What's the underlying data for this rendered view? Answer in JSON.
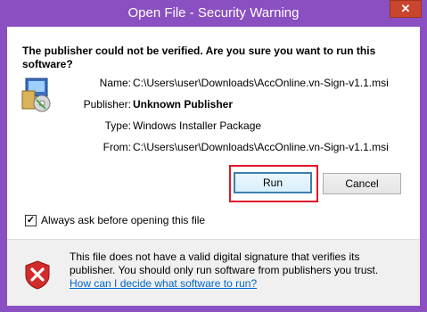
{
  "window": {
    "title": "Open File - Security Warning",
    "close_glyph": "✕"
  },
  "dialog": {
    "question": "The publisher could not be verified.  Are you sure you want to run this software?",
    "details": [
      {
        "label": "Name:",
        "value": "C:\\Users\\user\\Downloads\\AccOnline.vn-Sign-v1.1.msi",
        "bold": false
      },
      {
        "label": "Publisher:",
        "value": "Unknown Publisher",
        "bold": true
      },
      {
        "label": "Type:",
        "value": "Windows Installer Package",
        "bold": false
      },
      {
        "label": "From:",
        "value": "C:\\Users\\user\\Downloads\\AccOnline.vn-Sign-v1.1.msi",
        "bold": false
      }
    ],
    "run_label": "Run",
    "cancel_label": "Cancel",
    "checkbox_label": "Always ask before opening this file",
    "checkbox_checked": true,
    "checkbox_glyph": "✓"
  },
  "warning": {
    "text": "This file does not have a valid digital signature that verifies its publisher.  You should only run software from publishers you trust.",
    "link": "How can I decide what software to run?"
  },
  "colors": {
    "frame": "#8a4fc0",
    "highlight": "#e0142a",
    "link": "#0066cc"
  }
}
